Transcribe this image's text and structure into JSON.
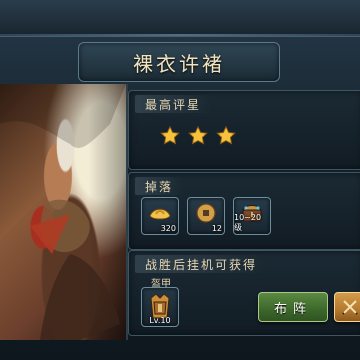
{
  "title": "裸衣许褚",
  "sections": {
    "rating": {
      "header": "最高评星",
      "stars": 3
    },
    "drops": {
      "header": "掉落",
      "items": [
        {
          "icon": "ingot-icon",
          "count": "320"
        },
        {
          "icon": "coin-icon",
          "count": "12"
        },
        {
          "icon": "chest-icon",
          "count": "10~20级"
        }
      ]
    },
    "idle": {
      "header": "战胜后挂机可获得",
      "item_name": "盔甲",
      "item_level": "Lv.10"
    }
  },
  "buttons": {
    "lineup": "布阵"
  },
  "colors": {
    "panel_bg": "#121c24",
    "panel_border": "#3d5664",
    "title_text": "#f1e3bd",
    "green_button": "#4a7a34",
    "orange_button": "#b57a2e",
    "star_fill": "#f6c23b"
  }
}
